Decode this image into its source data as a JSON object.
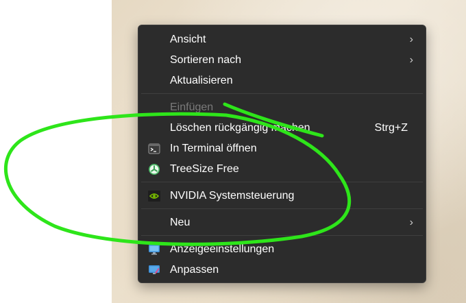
{
  "menu": {
    "items": [
      {
        "label": "Ansicht",
        "submenu": true
      },
      {
        "label": "Sortieren nach",
        "submenu": true
      },
      {
        "label": "Aktualisieren"
      },
      {
        "label": "Einfügen",
        "disabled": true
      },
      {
        "label": "Löschen rückgängig machen",
        "shortcut": "Strg+Z"
      },
      {
        "label": "In Terminal öffnen",
        "icon": "terminal-icon"
      },
      {
        "label": "TreeSize Free",
        "icon": "treesize-icon"
      },
      {
        "label": "NVIDIA Systemsteuerung",
        "icon": "nvidia-icon"
      },
      {
        "label": "Neu",
        "submenu": true
      },
      {
        "label": "Anzeigeeinstellungen",
        "icon": "display-settings-icon"
      },
      {
        "label": "Anpassen",
        "icon": "personalize-icon"
      }
    ],
    "chevron": "›"
  },
  "colors": {
    "menu_bg": "#2c2c2c",
    "annotation": "#2ee51a"
  }
}
